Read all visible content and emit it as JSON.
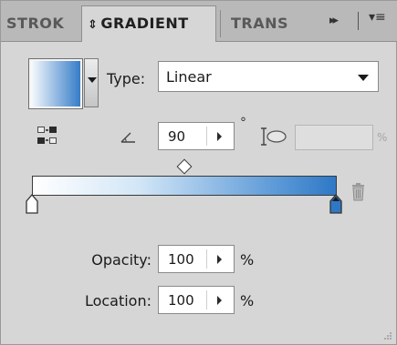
{
  "tabs": {
    "stroke": "STROK",
    "gradient": "GRADIENT",
    "transparency": "TRANS"
  },
  "icons": {
    "swap": "⇕",
    "forward": "▸▸",
    "menu": "▾≡"
  },
  "type": {
    "label": "Type:",
    "value": "Linear"
  },
  "angle": {
    "value": "90",
    "unit": "°"
  },
  "aspect": {
    "value": "",
    "unit": "%"
  },
  "opacity": {
    "label": "Opacity:",
    "value": "100",
    "unit": "%"
  },
  "location": {
    "label": "Location:",
    "value": "100",
    "unit": "%"
  },
  "colors": {
    "gradient_start": "#ffffff",
    "gradient_end": "#2e78c6",
    "panel_bg": "#d6d6d6"
  }
}
